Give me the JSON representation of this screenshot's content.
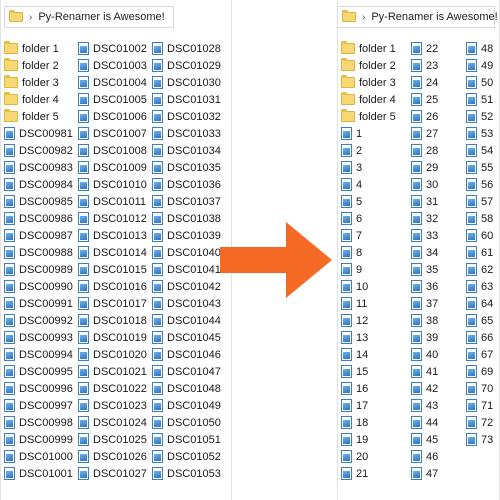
{
  "colors": {
    "arrow": "#f46a24",
    "folder": "#f8d775",
    "image_icon": "#2e74c0"
  },
  "left_pane": {
    "address": {
      "icon": "folder-icon",
      "separator": "›",
      "path": "Py-Renamer is Awesome!"
    },
    "items": [
      {
        "name": "folder 1",
        "icon": "folder-icon"
      },
      {
        "name": "folder 2",
        "icon": "folder-icon"
      },
      {
        "name": "folder 3",
        "icon": "folder-icon"
      },
      {
        "name": "folder 4",
        "icon": "folder-icon"
      },
      {
        "name": "folder 5",
        "icon": "folder-icon"
      },
      {
        "name": "DSC00981",
        "icon": "image-file-icon"
      },
      {
        "name": "DSC00982",
        "icon": "image-file-icon"
      },
      {
        "name": "DSC00983",
        "icon": "image-file-icon"
      },
      {
        "name": "DSC00984",
        "icon": "image-file-icon"
      },
      {
        "name": "DSC00985",
        "icon": "image-file-icon"
      },
      {
        "name": "DSC00986",
        "icon": "image-file-icon"
      },
      {
        "name": "DSC00987",
        "icon": "image-file-icon"
      },
      {
        "name": "DSC00988",
        "icon": "image-file-icon"
      },
      {
        "name": "DSC00989",
        "icon": "image-file-icon"
      },
      {
        "name": "DSC00990",
        "icon": "image-file-icon"
      },
      {
        "name": "DSC00991",
        "icon": "image-file-icon"
      },
      {
        "name": "DSC00992",
        "icon": "image-file-icon"
      },
      {
        "name": "DSC00993",
        "icon": "image-file-icon"
      },
      {
        "name": "DSC00994",
        "icon": "image-file-icon"
      },
      {
        "name": "DSC00995",
        "icon": "image-file-icon"
      },
      {
        "name": "DSC00996",
        "icon": "image-file-icon"
      },
      {
        "name": "DSC00997",
        "icon": "image-file-icon"
      },
      {
        "name": "DSC00998",
        "icon": "image-file-icon"
      },
      {
        "name": "DSC00999",
        "icon": "image-file-icon"
      },
      {
        "name": "DSC01000",
        "icon": "image-file-icon"
      },
      {
        "name": "DSC01001",
        "icon": "image-file-icon"
      },
      {
        "name": "DSC01002",
        "icon": "image-file-icon"
      },
      {
        "name": "DSC01003",
        "icon": "image-file-icon"
      },
      {
        "name": "DSC01004",
        "icon": "image-file-icon"
      },
      {
        "name": "DSC01005",
        "icon": "image-file-icon"
      },
      {
        "name": "DSC01006",
        "icon": "image-file-icon"
      },
      {
        "name": "DSC01007",
        "icon": "image-file-icon"
      },
      {
        "name": "DSC01008",
        "icon": "image-file-icon"
      },
      {
        "name": "DSC01009",
        "icon": "image-file-icon"
      },
      {
        "name": "DSC01010",
        "icon": "image-file-icon"
      },
      {
        "name": "DSC01011",
        "icon": "image-file-icon"
      },
      {
        "name": "DSC01012",
        "icon": "image-file-icon"
      },
      {
        "name": "DSC01013",
        "icon": "image-file-icon"
      },
      {
        "name": "DSC01014",
        "icon": "image-file-icon"
      },
      {
        "name": "DSC01015",
        "icon": "image-file-icon"
      },
      {
        "name": "DSC01016",
        "icon": "image-file-icon"
      },
      {
        "name": "DSC01017",
        "icon": "image-file-icon"
      },
      {
        "name": "DSC01018",
        "icon": "image-file-icon"
      },
      {
        "name": "DSC01019",
        "icon": "image-file-icon"
      },
      {
        "name": "DSC01020",
        "icon": "image-file-icon"
      },
      {
        "name": "DSC01021",
        "icon": "image-file-icon"
      },
      {
        "name": "DSC01022",
        "icon": "image-file-icon"
      },
      {
        "name": "DSC01023",
        "icon": "image-file-icon"
      },
      {
        "name": "DSC01024",
        "icon": "image-file-icon"
      },
      {
        "name": "DSC01025",
        "icon": "image-file-icon"
      },
      {
        "name": "DSC01026",
        "icon": "image-file-icon"
      },
      {
        "name": "DSC01027",
        "icon": "image-file-icon"
      },
      {
        "name": "DSC01028",
        "icon": "image-file-icon"
      },
      {
        "name": "DSC01029",
        "icon": "image-file-icon"
      },
      {
        "name": "DSC01030",
        "icon": "image-file-icon"
      },
      {
        "name": "DSC01031",
        "icon": "image-file-icon"
      },
      {
        "name": "DSC01032",
        "icon": "image-file-icon"
      },
      {
        "name": "DSC01033",
        "icon": "image-file-icon"
      },
      {
        "name": "DSC01034",
        "icon": "image-file-icon"
      },
      {
        "name": "DSC01035",
        "icon": "image-file-icon"
      },
      {
        "name": "DSC01036",
        "icon": "image-file-icon"
      },
      {
        "name": "DSC01037",
        "icon": "image-file-icon"
      },
      {
        "name": "DSC01038",
        "icon": "image-file-icon"
      },
      {
        "name": "DSC01039",
        "icon": "image-file-icon"
      },
      {
        "name": "DSC01040",
        "icon": "image-file-icon"
      },
      {
        "name": "DSC01041",
        "icon": "image-file-icon"
      },
      {
        "name": "DSC01042",
        "icon": "image-file-icon"
      },
      {
        "name": "DSC01043",
        "icon": "image-file-icon"
      },
      {
        "name": "DSC01044",
        "icon": "image-file-icon"
      },
      {
        "name": "DSC01045",
        "icon": "image-file-icon"
      },
      {
        "name": "DSC01046",
        "icon": "image-file-icon"
      },
      {
        "name": "DSC01047",
        "icon": "image-file-icon"
      },
      {
        "name": "DSC01048",
        "icon": "image-file-icon"
      },
      {
        "name": "DSC01049",
        "icon": "image-file-icon"
      },
      {
        "name": "DSC01050",
        "icon": "image-file-icon"
      },
      {
        "name": "DSC01051",
        "icon": "image-file-icon"
      },
      {
        "name": "DSC01052",
        "icon": "image-file-icon"
      },
      {
        "name": "DSC01053",
        "icon": "image-file-icon"
      }
    ]
  },
  "arrow": {
    "icon": "right-arrow-icon"
  },
  "right_pane": {
    "address": {
      "icon": "folder-icon",
      "separator": "›",
      "path": "Py-Renamer is Awesome!"
    },
    "items": [
      {
        "name": "folder 1",
        "icon": "folder-icon"
      },
      {
        "name": "folder 2",
        "icon": "folder-icon"
      },
      {
        "name": "folder 3",
        "icon": "folder-icon"
      },
      {
        "name": "folder 4",
        "icon": "folder-icon"
      },
      {
        "name": "folder 5",
        "icon": "folder-icon"
      },
      {
        "name": "1",
        "icon": "image-file-icon"
      },
      {
        "name": "2",
        "icon": "image-file-icon"
      },
      {
        "name": "3",
        "icon": "image-file-icon"
      },
      {
        "name": "4",
        "icon": "image-file-icon"
      },
      {
        "name": "5",
        "icon": "image-file-icon"
      },
      {
        "name": "6",
        "icon": "image-file-icon"
      },
      {
        "name": "7",
        "icon": "image-file-icon"
      },
      {
        "name": "8",
        "icon": "image-file-icon"
      },
      {
        "name": "9",
        "icon": "image-file-icon"
      },
      {
        "name": "10",
        "icon": "image-file-icon"
      },
      {
        "name": "11",
        "icon": "image-file-icon"
      },
      {
        "name": "12",
        "icon": "image-file-icon"
      },
      {
        "name": "13",
        "icon": "image-file-icon"
      },
      {
        "name": "14",
        "icon": "image-file-icon"
      },
      {
        "name": "15",
        "icon": "image-file-icon"
      },
      {
        "name": "16",
        "icon": "image-file-icon"
      },
      {
        "name": "17",
        "icon": "image-file-icon"
      },
      {
        "name": "18",
        "icon": "image-file-icon"
      },
      {
        "name": "19",
        "icon": "image-file-icon"
      },
      {
        "name": "20",
        "icon": "image-file-icon"
      },
      {
        "name": "21",
        "icon": "image-file-icon"
      },
      {
        "name": "22",
        "icon": "image-file-icon"
      },
      {
        "name": "23",
        "icon": "image-file-icon"
      },
      {
        "name": "24",
        "icon": "image-file-icon"
      },
      {
        "name": "25",
        "icon": "image-file-icon"
      },
      {
        "name": "26",
        "icon": "image-file-icon"
      },
      {
        "name": "27",
        "icon": "image-file-icon"
      },
      {
        "name": "28",
        "icon": "image-file-icon"
      },
      {
        "name": "29",
        "icon": "image-file-icon"
      },
      {
        "name": "30",
        "icon": "image-file-icon"
      },
      {
        "name": "31",
        "icon": "image-file-icon"
      },
      {
        "name": "32",
        "icon": "image-file-icon"
      },
      {
        "name": "33",
        "icon": "image-file-icon"
      },
      {
        "name": "34",
        "icon": "image-file-icon"
      },
      {
        "name": "35",
        "icon": "image-file-icon"
      },
      {
        "name": "36",
        "icon": "image-file-icon"
      },
      {
        "name": "37",
        "icon": "image-file-icon"
      },
      {
        "name": "38",
        "icon": "image-file-icon"
      },
      {
        "name": "39",
        "icon": "image-file-icon"
      },
      {
        "name": "40",
        "icon": "image-file-icon"
      },
      {
        "name": "41",
        "icon": "image-file-icon"
      },
      {
        "name": "42",
        "icon": "image-file-icon"
      },
      {
        "name": "43",
        "icon": "image-file-icon"
      },
      {
        "name": "44",
        "icon": "image-file-icon"
      },
      {
        "name": "45",
        "icon": "image-file-icon"
      },
      {
        "name": "46",
        "icon": "image-file-icon"
      },
      {
        "name": "47",
        "icon": "image-file-icon"
      },
      {
        "name": "48",
        "icon": "image-file-icon"
      },
      {
        "name": "49",
        "icon": "image-file-icon"
      },
      {
        "name": "50",
        "icon": "image-file-icon"
      },
      {
        "name": "51",
        "icon": "image-file-icon"
      },
      {
        "name": "52",
        "icon": "image-file-icon"
      },
      {
        "name": "53",
        "icon": "image-file-icon"
      },
      {
        "name": "54",
        "icon": "image-file-icon"
      },
      {
        "name": "55",
        "icon": "image-file-icon"
      },
      {
        "name": "56",
        "icon": "image-file-icon"
      },
      {
        "name": "57",
        "icon": "image-file-icon"
      },
      {
        "name": "58",
        "icon": "image-file-icon"
      },
      {
        "name": "60",
        "icon": "image-file-icon"
      },
      {
        "name": "61",
        "icon": "image-file-icon"
      },
      {
        "name": "62",
        "icon": "image-file-icon"
      },
      {
        "name": "63",
        "icon": "image-file-icon"
      },
      {
        "name": "64",
        "icon": "image-file-icon"
      },
      {
        "name": "65",
        "icon": "image-file-icon"
      },
      {
        "name": "66",
        "icon": "image-file-icon"
      },
      {
        "name": "67",
        "icon": "image-file-icon"
      },
      {
        "name": "69",
        "icon": "image-file-icon"
      },
      {
        "name": "70",
        "icon": "image-file-icon"
      },
      {
        "name": "71",
        "icon": "image-file-icon"
      },
      {
        "name": "72",
        "icon": "image-file-icon"
      },
      {
        "name": "73",
        "icon": "image-file-icon"
      }
    ]
  }
}
